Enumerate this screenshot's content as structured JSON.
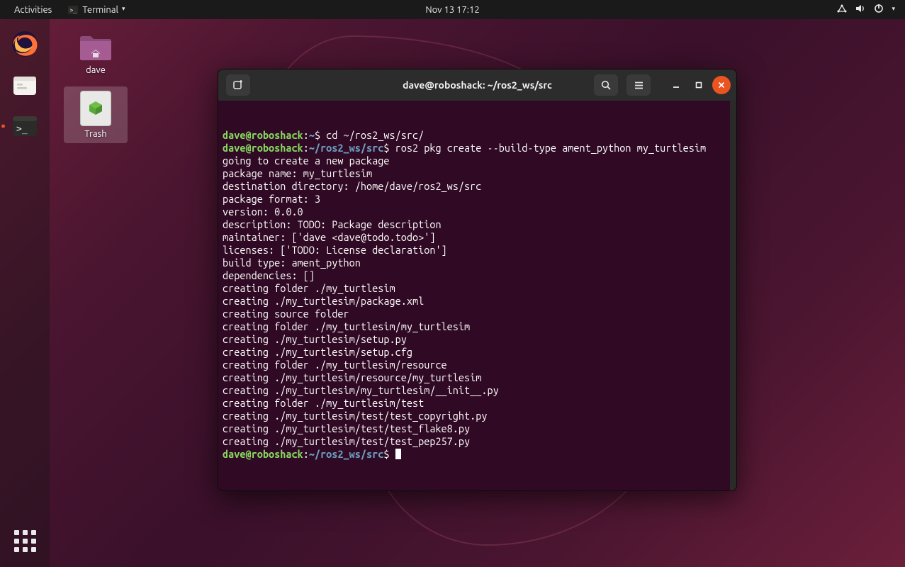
{
  "topbar": {
    "activities": "Activities",
    "app_name": "Terminal",
    "datetime": "Nov 13  17:12"
  },
  "desktop": {
    "folder1_label": "dave",
    "trash_label": "Trash"
  },
  "terminal": {
    "title": "dave@roboshack: ~/ros2_ws/src",
    "lines": [
      {
        "segments": [
          {
            "cls": "c-green",
            "text": "dave@roboshack"
          },
          {
            "cls": "c-white",
            "text": ":"
          },
          {
            "cls": "c-blue",
            "text": "~"
          },
          {
            "cls": "c-white",
            "text": "$ cd ~/ros2_ws/src/"
          }
        ]
      },
      {
        "segments": [
          {
            "cls": "c-green",
            "text": "dave@roboshack"
          },
          {
            "cls": "c-white",
            "text": ":"
          },
          {
            "cls": "c-blue",
            "text": "~/ros2_ws/src"
          },
          {
            "cls": "c-white",
            "text": "$ ros2 pkg create --build-type ament_python my_turtlesim"
          }
        ]
      },
      {
        "segments": [
          {
            "cls": "c-white",
            "text": "going to create a new package"
          }
        ]
      },
      {
        "segments": [
          {
            "cls": "c-white",
            "text": "package name: my_turtlesim"
          }
        ]
      },
      {
        "segments": [
          {
            "cls": "c-white",
            "text": "destination directory: /home/dave/ros2_ws/src"
          }
        ]
      },
      {
        "segments": [
          {
            "cls": "c-white",
            "text": "package format: 3"
          }
        ]
      },
      {
        "segments": [
          {
            "cls": "c-white",
            "text": "version: 0.0.0"
          }
        ]
      },
      {
        "segments": [
          {
            "cls": "c-white",
            "text": "description: TODO: Package description"
          }
        ]
      },
      {
        "segments": [
          {
            "cls": "c-white",
            "text": "maintainer: ['dave <dave@todo.todo>']"
          }
        ]
      },
      {
        "segments": [
          {
            "cls": "c-white",
            "text": "licenses: ['TODO: License declaration']"
          }
        ]
      },
      {
        "segments": [
          {
            "cls": "c-white",
            "text": "build type: ament_python"
          }
        ]
      },
      {
        "segments": [
          {
            "cls": "c-white",
            "text": "dependencies: []"
          }
        ]
      },
      {
        "segments": [
          {
            "cls": "c-white",
            "text": "creating folder ./my_turtlesim"
          }
        ]
      },
      {
        "segments": [
          {
            "cls": "c-white",
            "text": "creating ./my_turtlesim/package.xml"
          }
        ]
      },
      {
        "segments": [
          {
            "cls": "c-white",
            "text": "creating source folder"
          }
        ]
      },
      {
        "segments": [
          {
            "cls": "c-white",
            "text": "creating folder ./my_turtlesim/my_turtlesim"
          }
        ]
      },
      {
        "segments": [
          {
            "cls": "c-white",
            "text": "creating ./my_turtlesim/setup.py"
          }
        ]
      },
      {
        "segments": [
          {
            "cls": "c-white",
            "text": "creating ./my_turtlesim/setup.cfg"
          }
        ]
      },
      {
        "segments": [
          {
            "cls": "c-white",
            "text": "creating folder ./my_turtlesim/resource"
          }
        ]
      },
      {
        "segments": [
          {
            "cls": "c-white",
            "text": "creating ./my_turtlesim/resource/my_turtlesim"
          }
        ]
      },
      {
        "segments": [
          {
            "cls": "c-white",
            "text": "creating ./my_turtlesim/my_turtlesim/__init__.py"
          }
        ]
      },
      {
        "segments": [
          {
            "cls": "c-white",
            "text": "creating folder ./my_turtlesim/test"
          }
        ]
      },
      {
        "segments": [
          {
            "cls": "c-white",
            "text": "creating ./my_turtlesim/test/test_copyright.py"
          }
        ]
      },
      {
        "segments": [
          {
            "cls": "c-white",
            "text": "creating ./my_turtlesim/test/test_flake8.py"
          }
        ]
      },
      {
        "segments": [
          {
            "cls": "c-white",
            "text": "creating ./my_turtlesim/test/test_pep257.py"
          }
        ]
      },
      {
        "segments": [
          {
            "cls": "c-green",
            "text": "dave@roboshack"
          },
          {
            "cls": "c-white",
            "text": ":"
          },
          {
            "cls": "c-blue",
            "text": "~/ros2_ws/src"
          },
          {
            "cls": "c-white",
            "text": "$ "
          },
          {
            "cls": "cursor",
            "text": ""
          }
        ]
      }
    ]
  }
}
